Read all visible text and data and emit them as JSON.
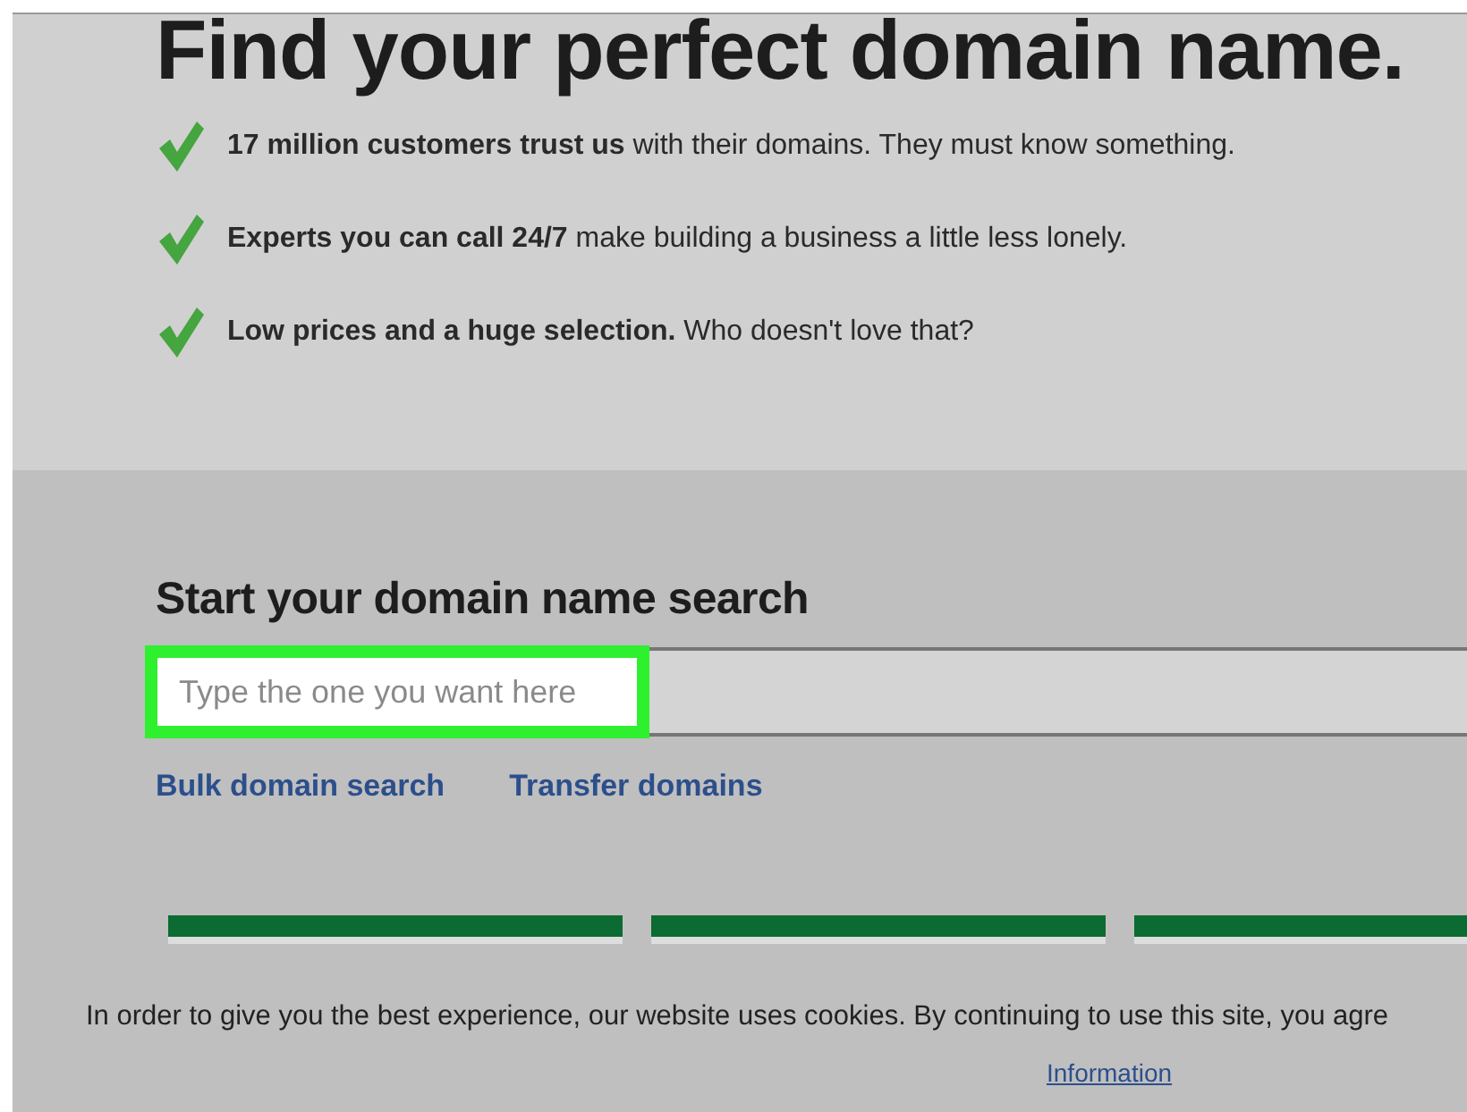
{
  "title": "Find your perfect domain name.",
  "benefits": [
    {
      "text": "**17 million customers trust us** with their domains. They must know something.",
      "checked": true
    },
    {
      "text": "**Experts you can call 24/7** make building a business a little less lonely.",
      "checked": true
    },
    {
      "text": "**Low prices and a huge selection.** Who doesn't love that?",
      "checked": true
    }
  ],
  "search": {
    "heading": "Start your domain name search",
    "placeholder": "Type the one you want here",
    "highlighted": true
  },
  "links": [
    "Bulk domain search",
    "Transfer domains"
  ],
  "cookie_notice": {
    "text": "In order to give you the best experience, our website uses cookies. By continuing to use this site, you agre",
    "link": "Information"
  }
}
